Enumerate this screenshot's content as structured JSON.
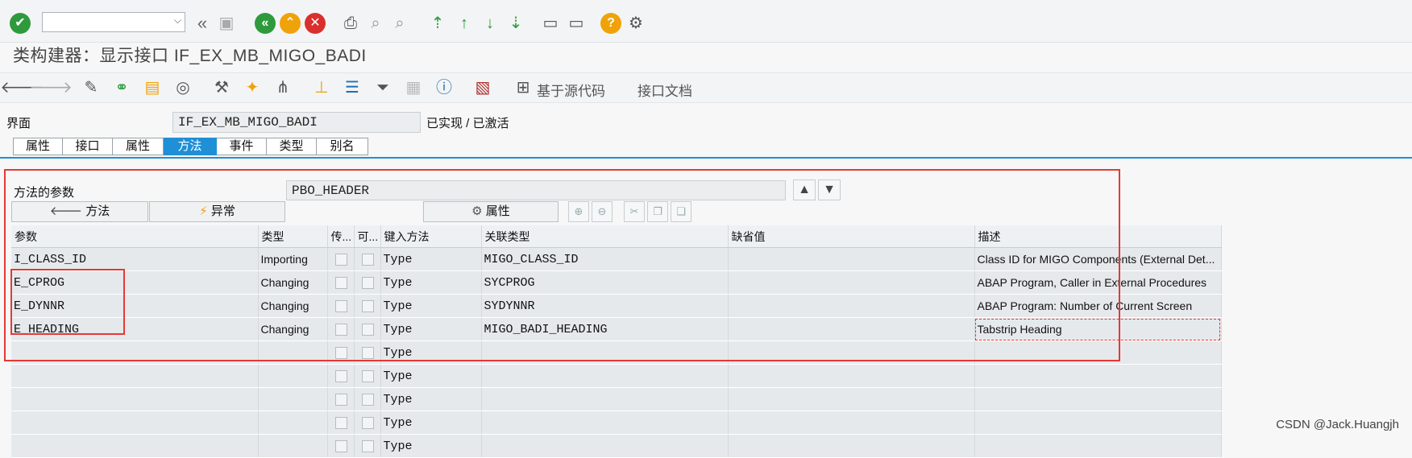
{
  "toolbar": {
    "command_value": "",
    "icons": [
      "check-icon",
      "back-double-icon",
      "save-icon",
      "back-icon",
      "exit-icon",
      "cancel-icon",
      "print-icon",
      "find-icon",
      "find-next-icon",
      "first-page-icon",
      "prev-page-icon",
      "next-page-icon",
      "last-page-icon",
      "new-session-icon",
      "shortcut-icon",
      "help-icon",
      "settings-icon"
    ]
  },
  "title": "类构建器：显示接口 IF_EX_MB_MIGO_BADI",
  "app_toolbar": {
    "source_code_label": "基于源代码",
    "interface_doc_label": "接口文档"
  },
  "interface": {
    "label": "界面",
    "value": "IF_EX_MB_MIGO_BADI",
    "status": "已实现 / 已激活"
  },
  "tabs": [
    {
      "label": "属性",
      "active": false
    },
    {
      "label": "接口",
      "active": false
    },
    {
      "label": "属性",
      "active": false
    },
    {
      "label": "方法",
      "active": true
    },
    {
      "label": "事件",
      "active": false
    },
    {
      "label": "类型",
      "active": false
    },
    {
      "label": "别名",
      "active": false
    }
  ],
  "params": {
    "label": "方法的参数",
    "method_value": "PBO_HEADER",
    "method_button": "方法",
    "exception_button": "异常",
    "attribute_button": "属性"
  },
  "table": {
    "headers": [
      "参数",
      "类型",
      "传...",
      "可...",
      "键入方法",
      "关联类型",
      "缺省值",
      "描述"
    ],
    "rows": [
      [
        "I_CLASS_ID",
        "Importing",
        "",
        "",
        "Type",
        "MIGO_CLASS_ID",
        "",
        "Class ID for MIGO Components (External Det..."
      ],
      [
        "E_CPROG",
        "Changing",
        "",
        "",
        "Type",
        "SYCPROG",
        "",
        "ABAP Program, Caller in External Procedures"
      ],
      [
        "E_DYNNR",
        "Changing",
        "",
        "",
        "Type",
        "SYDYNNR",
        "",
        "ABAP Program: Number of Current Screen"
      ],
      [
        "E_HEADING",
        "Changing",
        "",
        "",
        "Type",
        "MIGO_BADI_HEADING",
        "",
        "Tabstrip Heading"
      ],
      [
        "",
        "",
        "",
        "",
        "Type",
        "",
        "",
        ""
      ],
      [
        "",
        "",
        "",
        "",
        "Type",
        "",
        "",
        ""
      ],
      [
        "",
        "",
        "",
        "",
        "Type",
        "",
        "",
        ""
      ],
      [
        "",
        "",
        "",
        "",
        "Type",
        "",
        "",
        ""
      ],
      [
        "",
        "",
        "",
        "",
        "Type",
        "",
        "",
        ""
      ]
    ]
  },
  "watermark": "CSDN @Jack.Huangjh",
  "colors": {
    "accent": "#1f8fd6",
    "highlight": "#e53935"
  }
}
